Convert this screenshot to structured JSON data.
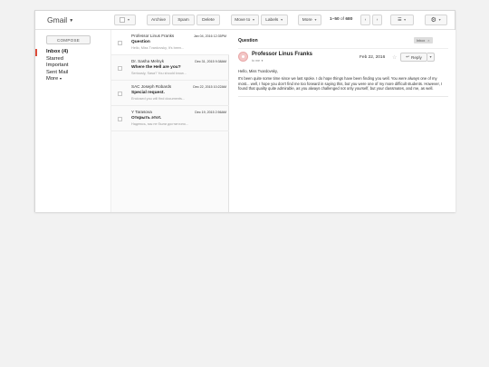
{
  "app": {
    "title": "Gmail"
  },
  "toolbar": {
    "archive": "Archive",
    "spam": "Spam",
    "delete": "Delete",
    "move_to": "Move to",
    "labels": "Labels",
    "more": "More",
    "pager": {
      "range": "1–50",
      "of": "of",
      "total": "680"
    }
  },
  "sidebar": {
    "compose": "COMPOSE",
    "items": [
      {
        "label": "Inbox (4)"
      },
      {
        "label": "Starred"
      },
      {
        "label": "Important"
      },
      {
        "label": "Sent Mail"
      },
      {
        "label": "More"
      }
    ]
  },
  "emails": [
    {
      "from": "Professor Linus Franks",
      "date": "Jan 04, 2016 12:35PM",
      "subject": "Question",
      "snippet": "Hello, Miss Tvardovsky, It's been..."
    },
    {
      "from": "Dr. Sasha Melnyk",
      "date": "Dec 31, 2015 9:38AM",
      "subject": "Where the Hell are you?",
      "snippet": "Seriously, Sasa? You should know..."
    },
    {
      "from": "SAC Joseph Robards",
      "date": "Dec 22, 2015 10:22AM",
      "subject": "Special request.",
      "snippet": "Enclosed you will find documents..."
    },
    {
      "from": "Y Tarasova",
      "date": "Dec 19, 2015 2:56AM",
      "subject": "Открыть этот.",
      "snippet": "Надеюсь, мы не были достаточно..."
    }
  ],
  "message": {
    "subject": "Question",
    "tag": "Inbox",
    "sender": "Professor Linus Franks",
    "to": "to me",
    "date": "Feb 22, 2016",
    "reply": "Reply",
    "greeting": "Hello, Miss Tvardovsky,",
    "body": "It's been quite some time since we last spoke. I do hope things have been finding you well. You were always one of my most... well, I hope you don't find me too forward in saying this, but you were one of my more difficult students. However, I found that quality quite admirable, as you always challenged not only yourself, but your classmates, and me, as well."
  },
  "colors": {
    "accent": "#dd4b39",
    "avatar": "#f3c6c6"
  }
}
